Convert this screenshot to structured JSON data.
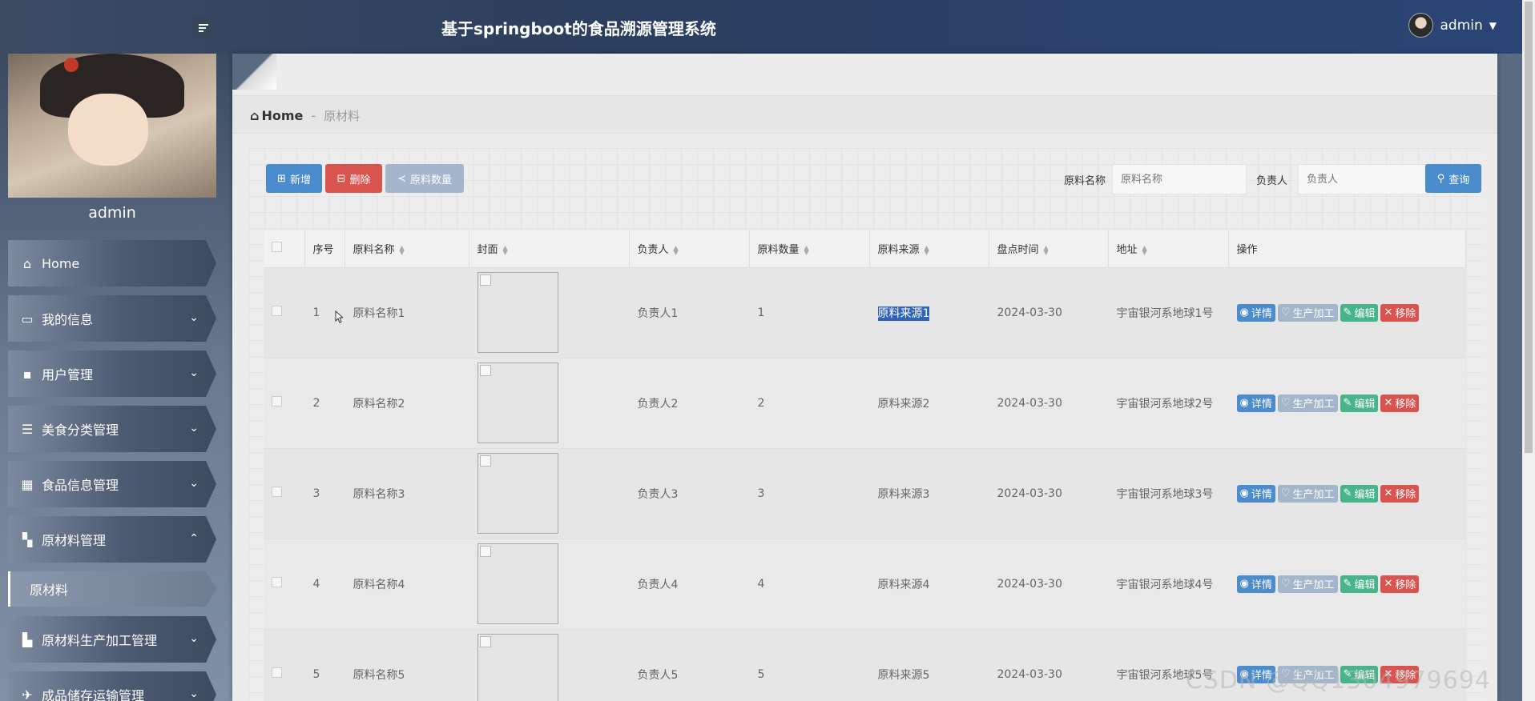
{
  "header": {
    "title": "基于springboot的食品溯源管理系统",
    "user": "admin"
  },
  "sidebar": {
    "user_name": "admin",
    "items": [
      {
        "label": "Home",
        "icon": "home-icon"
      },
      {
        "label": "我的信息",
        "icon": "card-icon"
      },
      {
        "label": "用户管理",
        "icon": "chat-icon"
      },
      {
        "label": "美食分类管理",
        "icon": "list-icon"
      },
      {
        "label": "食品信息管理",
        "icon": "grid-icon"
      },
      {
        "label": "原材料管理",
        "icon": "dashboard-icon"
      },
      {
        "label": "原材料生产加工管理",
        "icon": "book-icon"
      },
      {
        "label": "成品储存运输管理",
        "icon": "plane-icon"
      }
    ],
    "sub_item": "原材料"
  },
  "breadcrumb": {
    "home": "Home",
    "sep": "-",
    "current": "原材料"
  },
  "toolbar": {
    "add": "新增",
    "delete": "删除",
    "count": "原料数量",
    "search_name_label": "原料名称",
    "search_name_placeholder": "原料名称",
    "search_owner_label": "负责人",
    "search_owner_placeholder": "负责人",
    "search_btn": "查询"
  },
  "table": {
    "columns": [
      "序号",
      "原料名称",
      "封面",
      "负责人",
      "原料数量",
      "原料来源",
      "盘点时间",
      "地址",
      "操作"
    ],
    "ops": {
      "detail": "详情",
      "prod": "生产加工",
      "edit": "编辑",
      "remove": "移除"
    },
    "rows": [
      {
        "no": "1",
        "name": "原料名称1",
        "owner": "负责人1",
        "qty": "1",
        "source": "原料来源1",
        "date": "2024-03-30",
        "addr": "宇宙银河系地球1号"
      },
      {
        "no": "2",
        "name": "原料名称2",
        "owner": "负责人2",
        "qty": "2",
        "source": "原料来源2",
        "date": "2024-03-30",
        "addr": "宇宙银河系地球2号"
      },
      {
        "no": "3",
        "name": "原料名称3",
        "owner": "负责人3",
        "qty": "3",
        "source": "原料来源3",
        "date": "2024-03-30",
        "addr": "宇宙银河系地球3号"
      },
      {
        "no": "4",
        "name": "原料名称4",
        "owner": "负责人4",
        "qty": "4",
        "source": "原料来源4",
        "date": "2024-03-30",
        "addr": "宇宙银河系地球4号"
      },
      {
        "no": "5",
        "name": "原料名称5",
        "owner": "负责人5",
        "qty": "5",
        "source": "原料来源5",
        "date": "2024-03-30",
        "addr": "宇宙银河系地球5号"
      }
    ]
  },
  "watermark": "CSDN @QQ1304979694"
}
